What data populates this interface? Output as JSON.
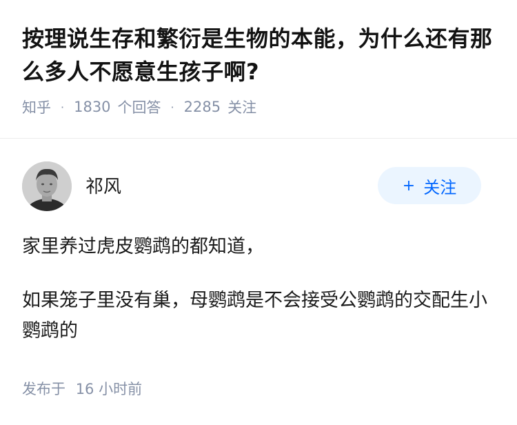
{
  "question": {
    "title": "按理说生存和繁衍是生物的本能，为什么还有那么多人不愿意生孩子啊?",
    "meta": {
      "source": "知乎",
      "answers_count": "1830",
      "answers_label": "个回答",
      "followers_count": "2285",
      "followers_label": "关注"
    }
  },
  "answer": {
    "author": {
      "name": "祁风",
      "avatar_icon": "user-avatar-photo"
    },
    "follow_button": {
      "plus": "+",
      "label": "关注"
    },
    "paragraphs": [
      "家里养过虎皮鹦鹉的都知道，",
      "如果笼子里没有巢，母鹦鹉是不会接受公鹦鹉的交配生小鹦鹉的"
    ],
    "publish": {
      "label": "发布于",
      "time": "16 小时前"
    }
  },
  "colors": {
    "meta_gray": "#8590a6",
    "brand_blue": "#0066ff",
    "follow_bg": "#ebf5ff"
  }
}
